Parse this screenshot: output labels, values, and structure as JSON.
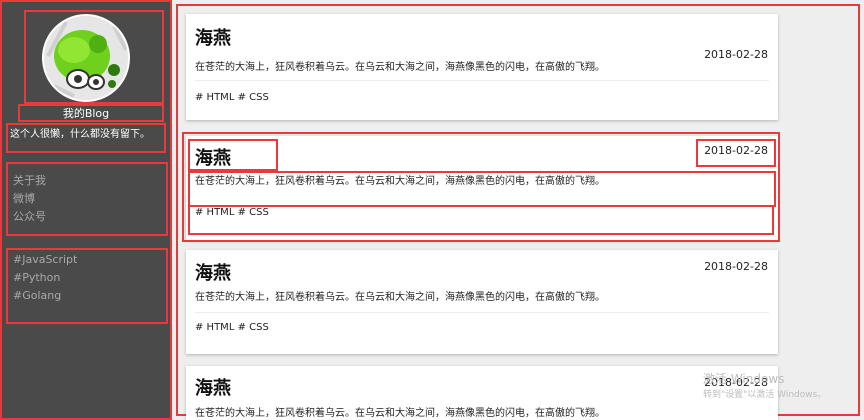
{
  "sidebar": {
    "blog_name": "我的Blog",
    "description": "这个人很懒，什么都没有留下。",
    "nav": [
      "关于我",
      "微博",
      "公众号"
    ],
    "tags": [
      "#JavaScript",
      "#Python",
      "#Golang"
    ]
  },
  "posts": [
    {
      "title": "海燕",
      "date": "2018-02-28",
      "summary": "在苍茫的大海上，狂风卷积着乌云。在乌云和大海之间，海燕像黑色的闪电，在高傲的飞翔。",
      "tags": "# HTML # CSS"
    },
    {
      "title": "海燕",
      "date": "2018-02-28",
      "summary": "在苍茫的大海上，狂风卷积着乌云。在乌云和大海之间，海燕像黑色的闪电，在高傲的飞翔。",
      "tags": "# HTML # CSS"
    },
    {
      "title": "海燕",
      "date": "2018-02-28",
      "summary": "在苍茫的大海上，狂风卷积着乌云。在乌云和大海之间，海燕像黑色的闪电，在高傲的飞翔。",
      "tags": "# HTML # CSS"
    },
    {
      "title": "海燕",
      "date": "2018-02-28",
      "summary": "在苍茫的大海上，狂风卷积着乌云。在乌云和大海之间，海燕像黑色的闪电，在高傲的飞翔。",
      "tags": ""
    }
  ],
  "watermark": {
    "line1": "激活 Windows",
    "line2": "转到\"设置\"以激活 Windows。"
  },
  "colors": {
    "sidebar_bg": "#4a4a4a",
    "highlight_border": "#e83a3a",
    "page_bg": "#eeeeee"
  }
}
